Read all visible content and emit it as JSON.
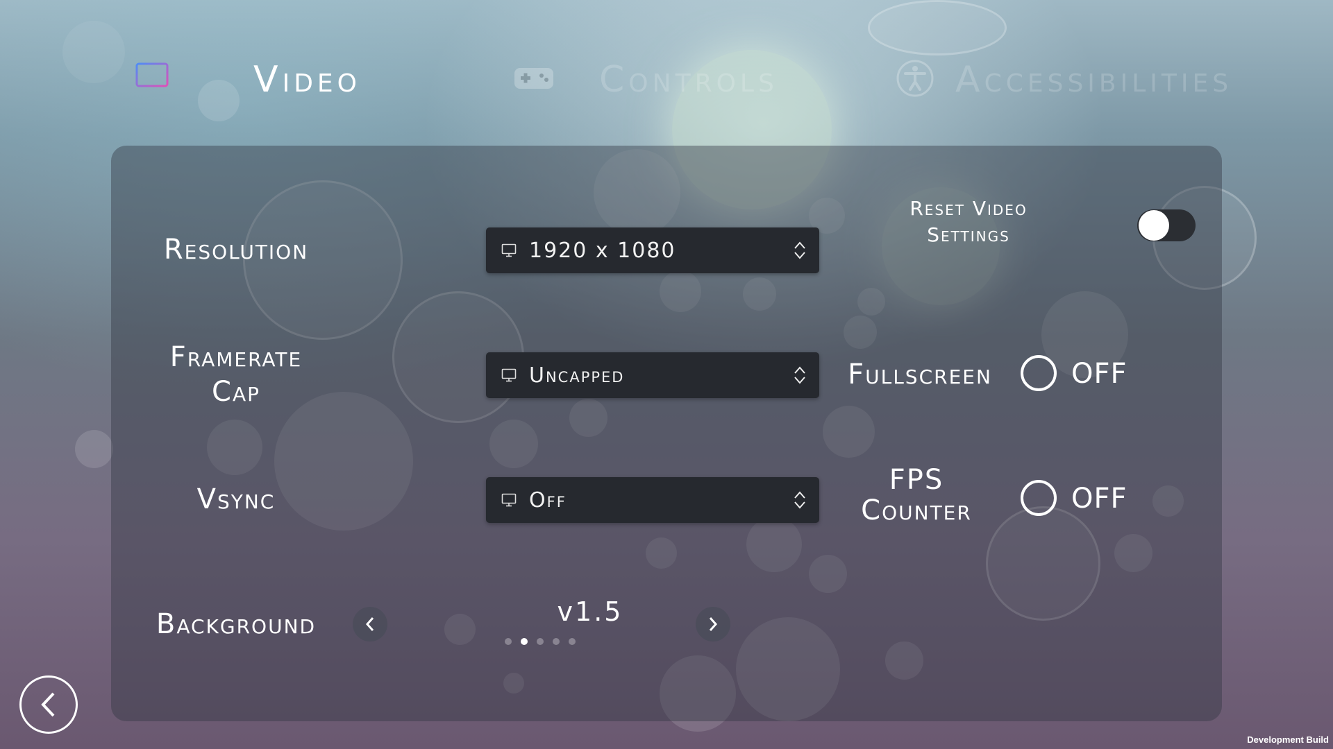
{
  "tabs": [
    {
      "label": "Video",
      "icon": "monitor-icon",
      "active": true
    },
    {
      "label": "Controls",
      "icon": "gamepad-icon",
      "active": false
    },
    {
      "label": "Accessibilities",
      "icon": "accessibility-icon",
      "active": false
    }
  ],
  "settings": {
    "resolution": {
      "label": "Resolution",
      "value": "1920 x 1080"
    },
    "framerate_cap": {
      "label_line1": "Framerate",
      "label_line2": "Cap",
      "value": "Uncapped"
    },
    "vsync": {
      "label": "Vsync",
      "value": "Off"
    },
    "background": {
      "label": "Background",
      "value": "v1.5",
      "page_count": 5,
      "current_page": 2
    }
  },
  "toggles": {
    "reset_video": {
      "label_line1": "Reset Video",
      "label_line2": "Settings",
      "on": false
    },
    "fullscreen": {
      "label": "Fullscreen",
      "state": "OFF"
    },
    "fps_counter": {
      "label_line1": "FPS",
      "label_line2": "Counter",
      "state": "OFF"
    }
  },
  "footer": {
    "build": "Development Build"
  },
  "colors": {
    "accent_gradient_start": "#4f8df5",
    "accent_gradient_end": "#e04fb8",
    "panel": "#323842",
    "dropdown": "#26292f"
  }
}
